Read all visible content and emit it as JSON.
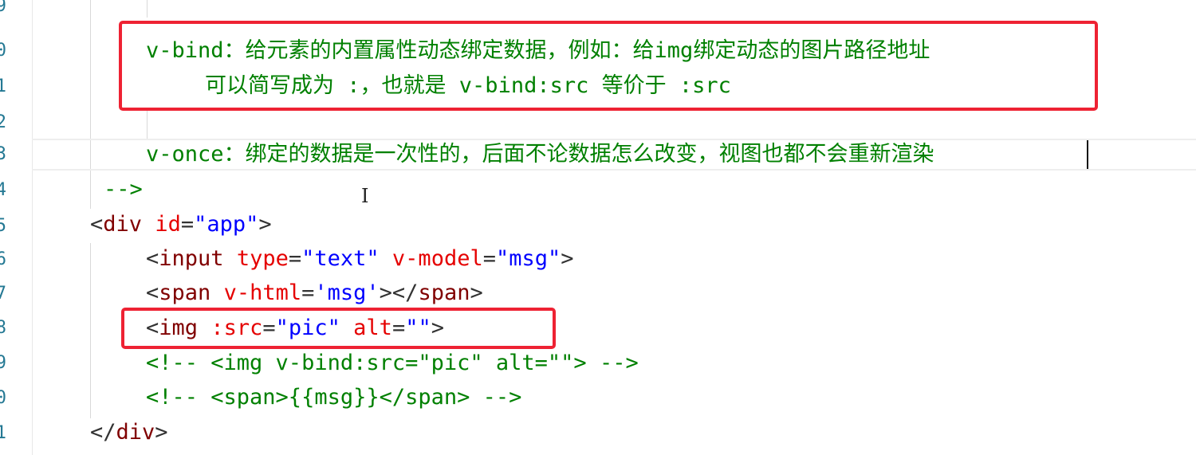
{
  "gutter": {
    "numbers": [
      "9",
      "0",
      "1",
      "2",
      "3",
      "4",
      "5",
      "6",
      "7",
      "8",
      "9",
      "0",
      "1"
    ]
  },
  "code": {
    "comment_vbind_keyword": "v-bind",
    "comment_vbind_text_1": "：给元素的内置属性动态绑定数据，例如：给",
    "comment_vbind_img": "img",
    "comment_vbind_text_2": "绑定动态的图片路径地址",
    "comment_vbind_line2_a": "可以简写成为 ",
    "comment_vbind_line2_b": ":",
    "comment_vbind_line2_c": "，也就是 ",
    "comment_vbind_line2_d": "v-bind:src",
    "comment_vbind_line2_e": " 等价于 ",
    "comment_vbind_line2_f": ":src",
    "comment_vonce_keyword": "v-once",
    "comment_vonce_text": "：绑定的数据是一次性的，后面不论数据怎么改变，视图也都不会重新渲染",
    "comment_close": "-->",
    "div_open_lt": "<",
    "div_tag": "div",
    "div_attr": "id",
    "div_eq": "=",
    "div_val": "\"app\"",
    "div_gt": ">",
    "input_lt": "<",
    "input_tag": "input",
    "input_attr1": "type",
    "input_val1": "\"text\"",
    "input_attr2": "v-model",
    "input_val2": "\"msg\"",
    "input_gt": ">",
    "span_lt": "<",
    "span_tag": "span",
    "span_attr": "v-html",
    "span_val": "'msg'",
    "span_close_mid": "></",
    "span_close_tag": "span",
    "span_gt": ">",
    "img_lt": "<",
    "img_tag": "img",
    "img_attr1": ":src",
    "img_val1": "\"pic\"",
    "img_attr2": "alt",
    "img_val2": "\"\"",
    "img_gt": ">",
    "comment_img": "<!-- <img v-bind:src=\"pic\" alt=\"\"> -->",
    "comment_span": "<!-- <span>{{msg}}</span> -->",
    "div_close_lt": "</",
    "div_close_tag": "div",
    "div_close_gt": ">"
  },
  "colors": {
    "comment": "#008000",
    "tag": "#800000",
    "attribute": "#e50000",
    "string": "#0000ff",
    "highlight_box": "#ee2233"
  }
}
